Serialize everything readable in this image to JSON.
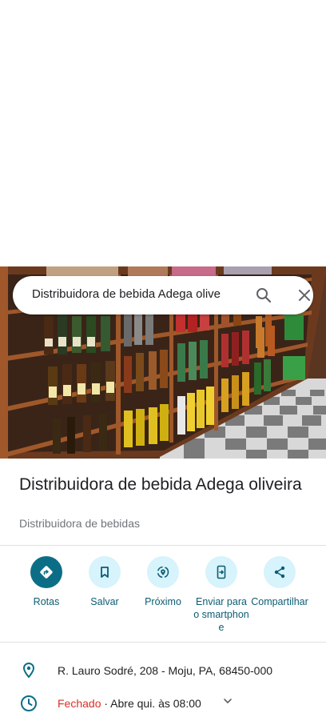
{
  "search": {
    "value": "Distribuidora de bebida Adega olive",
    "search_icon": "search-icon",
    "clear_icon": "close-icon"
  },
  "place": {
    "name": "Distribuidora de bebida Adega oliveira",
    "category": "Distribuidora de bebidas"
  },
  "actions": [
    {
      "label": "Rotas",
      "icon": "directions-icon"
    },
    {
      "label": "Salvar",
      "icon": "bookmark-icon"
    },
    {
      "label": "Próximo",
      "icon": "nearby-icon"
    },
    {
      "label": "Enviar para o smartphone",
      "icon": "send-to-phone-icon"
    },
    {
      "label": "Compartilhar",
      "icon": "share-icon"
    }
  ],
  "info": {
    "address": "R. Lauro Sodré, 208 - Moju, PA, 68450-000",
    "hours_status": "Fechado",
    "hours_detail": " · Abre qui. às 08:00"
  },
  "colors": {
    "accent": "#0b6e86",
    "action_bg": "#d7f3fb",
    "closed": "#d93025"
  }
}
